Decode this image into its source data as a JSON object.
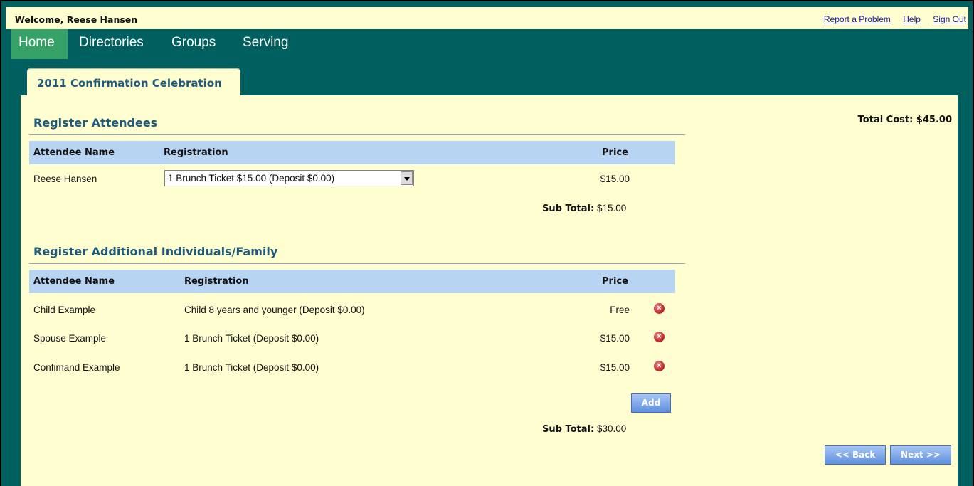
{
  "header": {
    "welcome": "Welcome, Reese Hansen",
    "links": [
      "Report a Problem",
      "Help",
      "Sign Out"
    ]
  },
  "nav": [
    "Home",
    "Directories",
    "Groups",
    "Serving"
  ],
  "tab_title": "2011 Confirmation Celebration",
  "total_cost": "Total Cost: $45.00",
  "register_attendees": {
    "title": "Register Attendees",
    "columns": {
      "name": "Attendee Name",
      "registration": "Registration",
      "price": "Price"
    },
    "row": {
      "name": "Reese Hansen",
      "selected_option": "1 Brunch Ticket $15.00 (Deposit $0.00)",
      "price": "$15.00"
    },
    "subtotal_label": "Sub Total:",
    "subtotal_value": "$15.00"
  },
  "additional": {
    "title": "Register Additional Individuals/Family",
    "columns": {
      "name": "Attendee Name",
      "registration": "Registration",
      "price": "Price"
    },
    "rows": [
      {
        "name": "Child Example",
        "registration": "Child 8 years and younger (Deposit $0.00)",
        "price": "Free"
      },
      {
        "name": "Spouse Example",
        "registration": "1 Brunch Ticket (Deposit $0.00)",
        "price": "$15.00"
      },
      {
        "name": "Confimand Example",
        "registration": "1 Brunch Ticket (Deposit $0.00)",
        "price": "$15.00"
      }
    ],
    "add_label": "Add",
    "subtotal_label": "Sub Total:",
    "subtotal_value": "$30.00"
  },
  "buttons": {
    "back": "<< Back",
    "next": "Next >>"
  },
  "icons": {
    "remove": "remove-circle-icon",
    "dropdown": "chevron-down-icon"
  },
  "colors": {
    "header_bg": "#006060",
    "active_tab": "#36a267",
    "content_bg": "#fefed0",
    "table_header": "#b7d4f2",
    "title_blue": "#1f5a7a"
  }
}
